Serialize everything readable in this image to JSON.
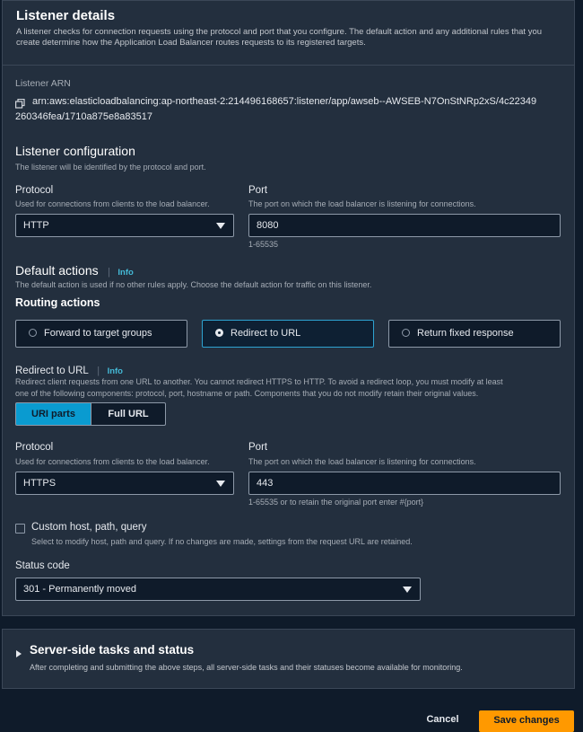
{
  "listener_details": {
    "title": "Listener details",
    "description": "A listener checks for connection requests using the protocol and port that you configure. The default action and any additional rules that you create determine how the Application Load Balancer routes requests to its registered targets."
  },
  "listener_arn": {
    "label": "Listener ARN",
    "value_line1": "arn:aws:elasticloadbalancing:ap-northeast-2:214496168657:listener/app/awseb--AWSEB-N7OnStNRp2xS/4c22349",
    "value_line2": "260346fea/1710a875e8a83517"
  },
  "listener_configuration": {
    "title": "Listener configuration",
    "description": "The listener will be identified by the protocol and port.",
    "protocol_label": "Protocol",
    "protocol_desc": "Used for connections from clients to the load balancer.",
    "protocol_value": "HTTP",
    "port_label": "Port",
    "port_desc": "The port on which the load balancer is listening for connections.",
    "port_value": "8080",
    "port_hint": "1-65535"
  },
  "default_actions": {
    "title": "Default actions",
    "info": "Info",
    "description": "The default action is used if no other rules apply. Choose the default action for traffic on this listener.",
    "routing_title": "Routing actions",
    "options": [
      "Forward to target groups",
      "Redirect to URL",
      "Return fixed response"
    ],
    "selected": "Redirect to URL"
  },
  "redirect": {
    "title": "Redirect to URL",
    "info": "Info",
    "description_line1": "Redirect client requests from one URL to another. You cannot redirect HTTPS to HTTP. To avoid a redirect loop, you must modify at least",
    "description_line2": "one of the following components: protocol, port, hostname or path. Components that you do not modify retain their original values.",
    "seg_uri": "URI parts",
    "seg_full": "Full URL",
    "protocol_label": "Protocol",
    "protocol_desc": "Used for connections from clients to the load balancer.",
    "protocol_value": "HTTPS",
    "port_label": "Port",
    "port_desc": "The port on which the load balancer is listening for connections.",
    "port_value": "443",
    "port_hint": "1-65535 or to retain the original port enter #{port}",
    "custom_label": "Custom host, path, query",
    "custom_desc": "Select to modify host, path and query. If no changes are made, settings from the request URL are retained.",
    "status_label": "Status code",
    "status_value": "301 - Permanently moved"
  },
  "server_side": {
    "title": "Server-side tasks and status",
    "description": "After completing and submitting the above steps, all server-side tasks and their statuses become available for monitoring."
  },
  "footer": {
    "cancel": "Cancel",
    "save": "Save changes"
  },
  "colors": {
    "accent": "#ff9900",
    "link": "#44b9d6",
    "selected_border": "#2ea3d1",
    "panel_bg": "#232f3e",
    "page_bg": "#0f1b2a"
  }
}
